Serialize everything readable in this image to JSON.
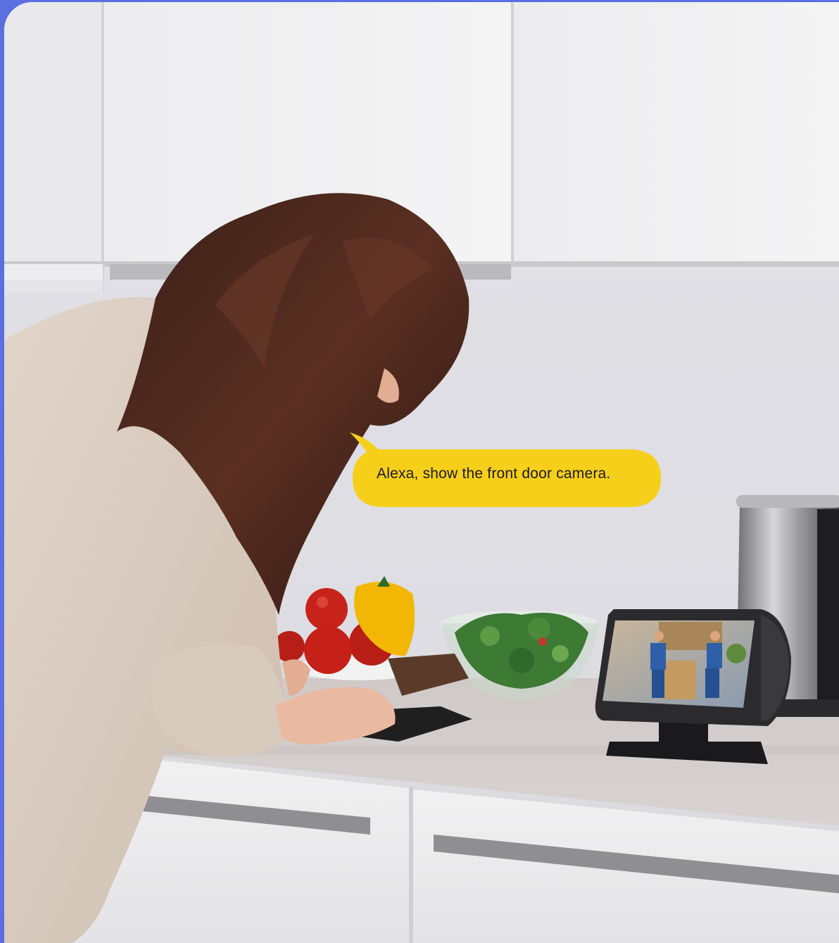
{
  "speech_bubble": {
    "text": "Alexa, show the front door camera."
  },
  "colors": {
    "frame": "#5b6fe0",
    "bubble": "#f6cf1b",
    "bubble_text": "#1a1a1a"
  },
  "scene": {
    "icon_names": [
      "woman",
      "smart-display",
      "kettle",
      "salad-bowl",
      "bell-pepper",
      "tomatoes",
      "cutting-board",
      "kitchen-cabinets",
      "drawers"
    ]
  }
}
